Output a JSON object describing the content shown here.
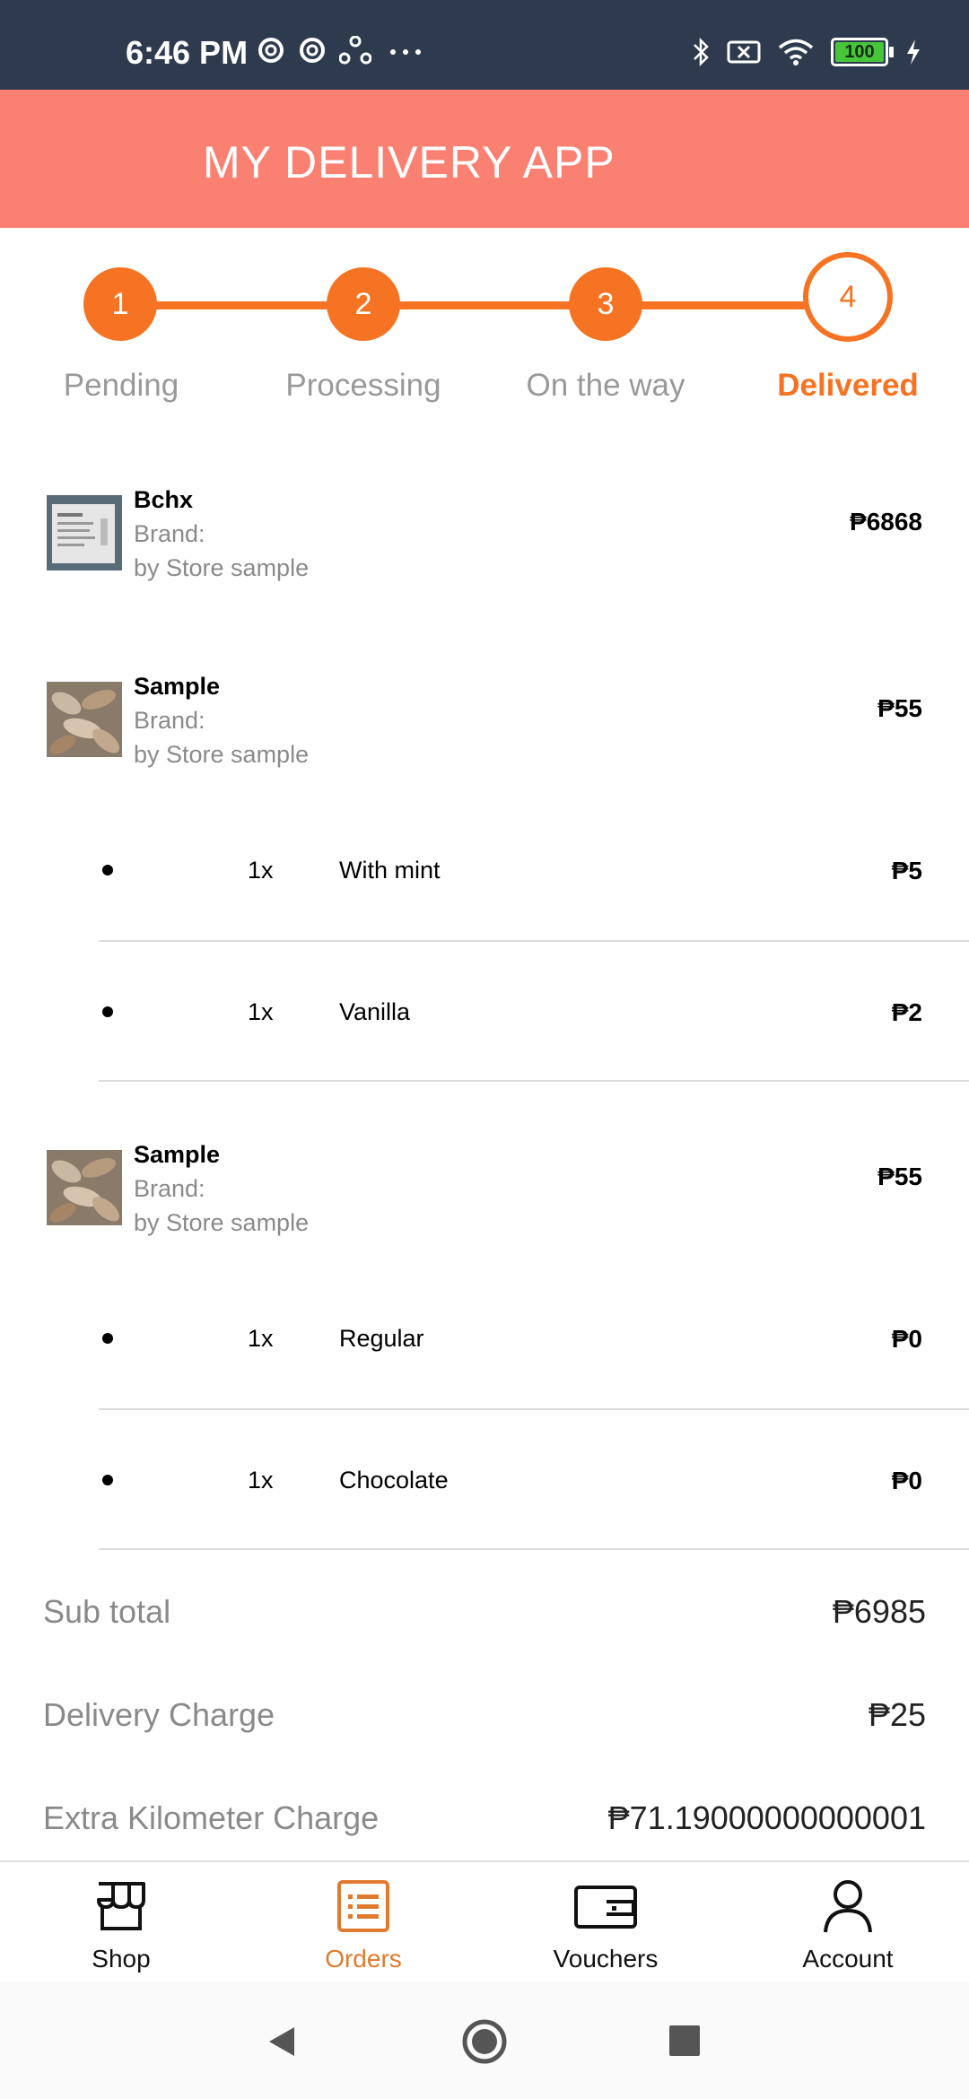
{
  "status": {
    "time": "6:46 PM",
    "battery": "100"
  },
  "app": {
    "title": "MY DELIVERY APP"
  },
  "stepper": {
    "steps": [
      {
        "number": "1",
        "label": "Pending"
      },
      {
        "number": "2",
        "label": "Processing"
      },
      {
        "number": "3",
        "label": "On the way"
      },
      {
        "number": "4",
        "label": "Delivered"
      }
    ],
    "active_index": 4
  },
  "items": [
    {
      "name": "Bchx",
      "brand": "Brand:",
      "store": "by Store sample",
      "price": "₱6868",
      "addons": []
    },
    {
      "name": "Sample",
      "brand": "Brand:",
      "store": "by Store sample",
      "price": "₱55",
      "addons": [
        {
          "qty": "1x",
          "name": "With mint",
          "price": "₱5"
        },
        {
          "qty": "1x",
          "name": "Vanilla",
          "price": "₱2"
        }
      ]
    },
    {
      "name": "Sample",
      "brand": "Brand:",
      "store": "by Store sample",
      "price": "₱55",
      "addons": [
        {
          "qty": "1x",
          "name": "Regular",
          "price": "₱0"
        },
        {
          "qty": "1x",
          "name": "Chocolate",
          "price": "₱0"
        }
      ]
    }
  ],
  "summary": {
    "subtotal_label": "Sub total",
    "subtotal_value": "₱6985",
    "delivery_label": "Delivery Charge",
    "delivery_value": "₱25",
    "extra_km_label": "Extra Kilometer Charge",
    "extra_km_value": "₱71.19000000000001"
  },
  "nav": {
    "items": [
      {
        "label": "Shop",
        "icon": "shop-icon"
      },
      {
        "label": "Orders",
        "icon": "orders-icon"
      },
      {
        "label": "Vouchers",
        "icon": "wallet-icon"
      },
      {
        "label": "Account",
        "icon": "account-icon"
      }
    ],
    "active_color": "#e07a2e"
  },
  "colors": {
    "header": "#fa8072",
    "accent": "#f57322",
    "statusbar": "#2e3b4e"
  }
}
